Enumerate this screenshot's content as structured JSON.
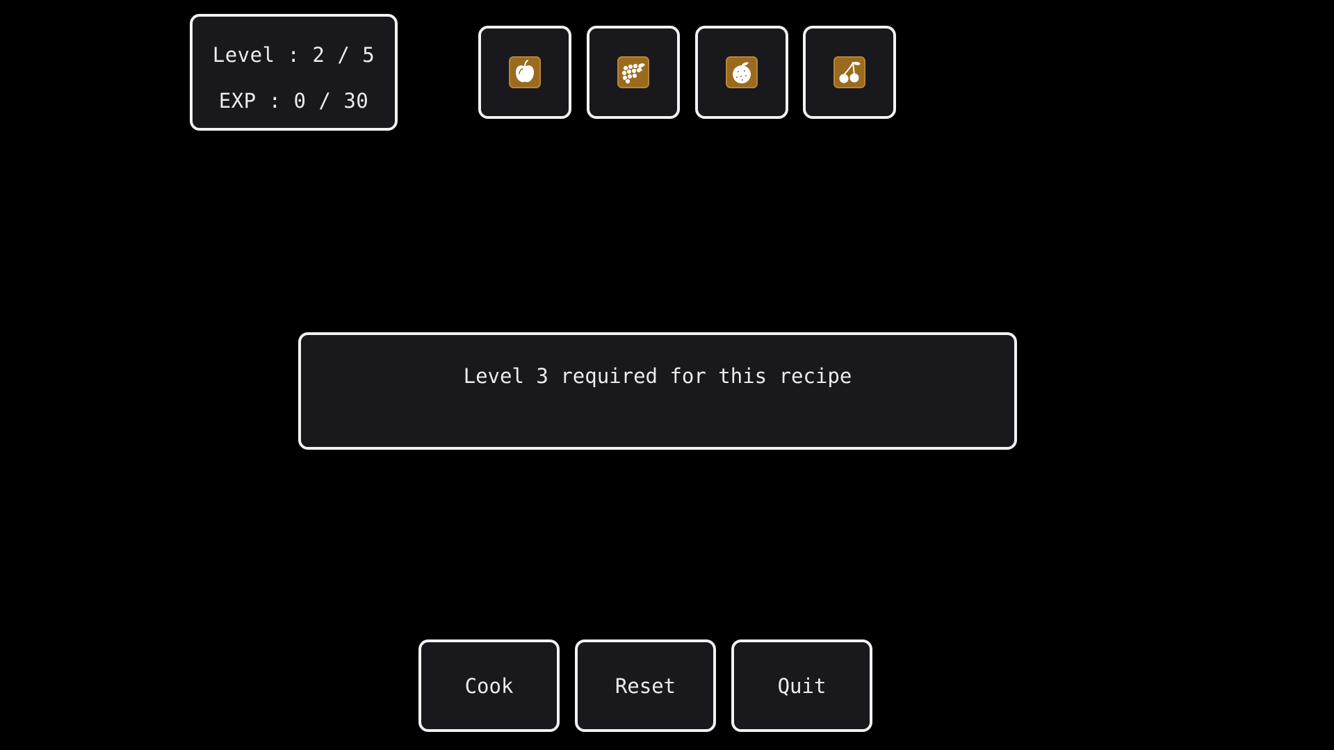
{
  "status": {
    "level_text": "Level : 2 / 5",
    "exp_text": "EXP : 0 / 30",
    "level": 2,
    "level_max": 5,
    "exp": 0,
    "exp_max": 30
  },
  "ingredients": [
    {
      "icon": "apple-icon"
    },
    {
      "icon": "grapes-icon"
    },
    {
      "icon": "orange-icon"
    },
    {
      "icon": "cherry-icon"
    }
  ],
  "message": {
    "text": "Level 3 required for this recipe"
  },
  "buttons": {
    "cook_label": "Cook",
    "reset_label": "Reset",
    "quit_label": "Quit"
  },
  "colors": {
    "background": "#000000",
    "panel": "#19181c",
    "border": "#f2f2f2",
    "icon_tile": "#9a6a1e",
    "text": "#ececec"
  }
}
